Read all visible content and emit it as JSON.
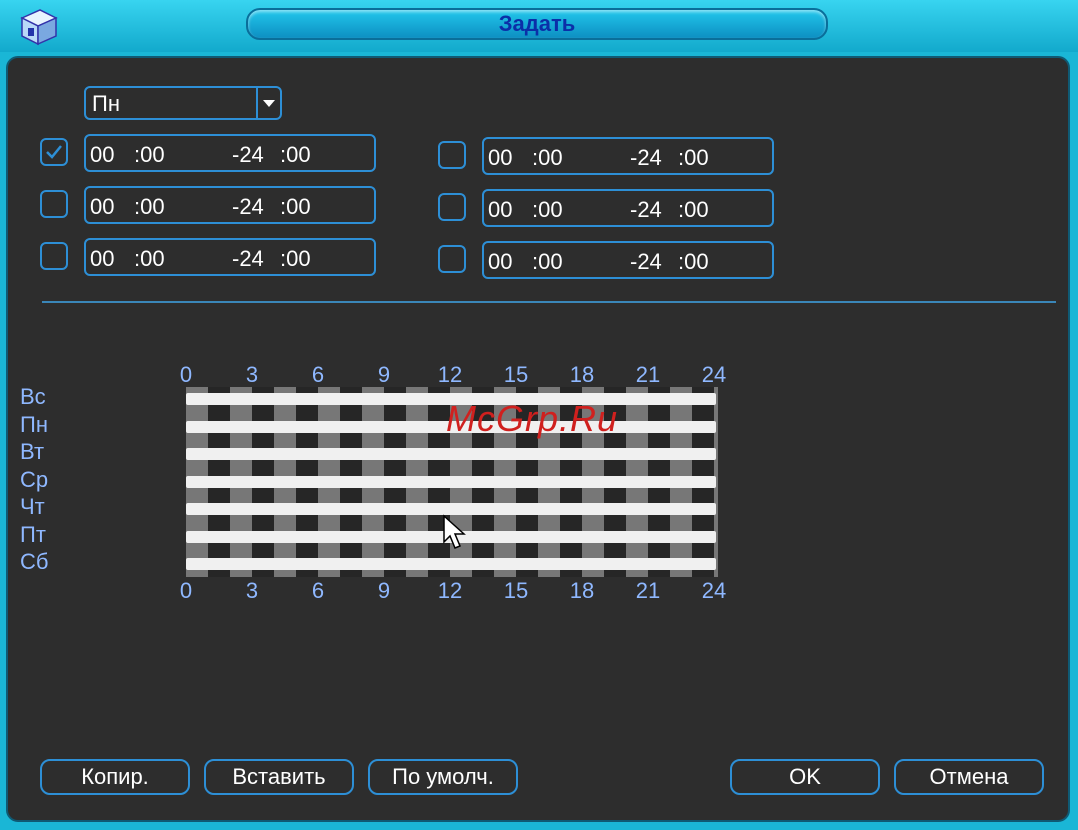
{
  "window": {
    "title": "Задать"
  },
  "day_select": {
    "value": "Пн"
  },
  "periods": [
    {
      "checked": true,
      "start_h": "00",
      "start_m": ":00",
      "end_h": "-24",
      "end_m": ":00"
    },
    {
      "checked": false,
      "start_h": "00",
      "start_m": ":00",
      "end_h": "-24",
      "end_m": ":00"
    },
    {
      "checked": false,
      "start_h": "00",
      "start_m": ":00",
      "end_h": "-24",
      "end_m": ":00"
    },
    {
      "checked": false,
      "start_h": "00",
      "start_m": ":00",
      "end_h": "-24",
      "end_m": ":00"
    },
    {
      "checked": false,
      "start_h": "00",
      "start_m": ":00",
      "end_h": "-24",
      "end_m": ":00"
    },
    {
      "checked": false,
      "start_h": "00",
      "start_m": ":00",
      "end_h": "-24",
      "end_m": ":00"
    }
  ],
  "schedule": {
    "hours": [
      "0",
      "3",
      "6",
      "9",
      "12",
      "15",
      "18",
      "21",
      "24"
    ],
    "days": [
      "Вс",
      "Пн",
      "Вт",
      "Ср",
      "Чт",
      "Пт",
      "Сб"
    ],
    "coverage": [
      {
        "day": "Вс",
        "start": 0,
        "end": 24
      },
      {
        "day": "Пн",
        "start": 0,
        "end": 24
      },
      {
        "day": "Вт",
        "start": 0,
        "end": 24
      },
      {
        "day": "Ср",
        "start": 0,
        "end": 24
      },
      {
        "day": "Чт",
        "start": 0,
        "end": 24
      },
      {
        "day": "Пт",
        "start": 0,
        "end": 24
      },
      {
        "day": "Сб",
        "start": 0,
        "end": 24
      }
    ]
  },
  "buttons": {
    "copy": "Копир.",
    "paste": "Вставить",
    "default": "По умолч.",
    "ok": "OK",
    "cancel": "Отмена"
  },
  "watermark": "McGrp.Ru",
  "colors": {
    "accent": "#2d8fd6",
    "title_text": "#0b2fa8",
    "label_blue": "#8fb8ff",
    "schedule_bar": "#f0f0f0",
    "watermark": "#d0201e"
  }
}
